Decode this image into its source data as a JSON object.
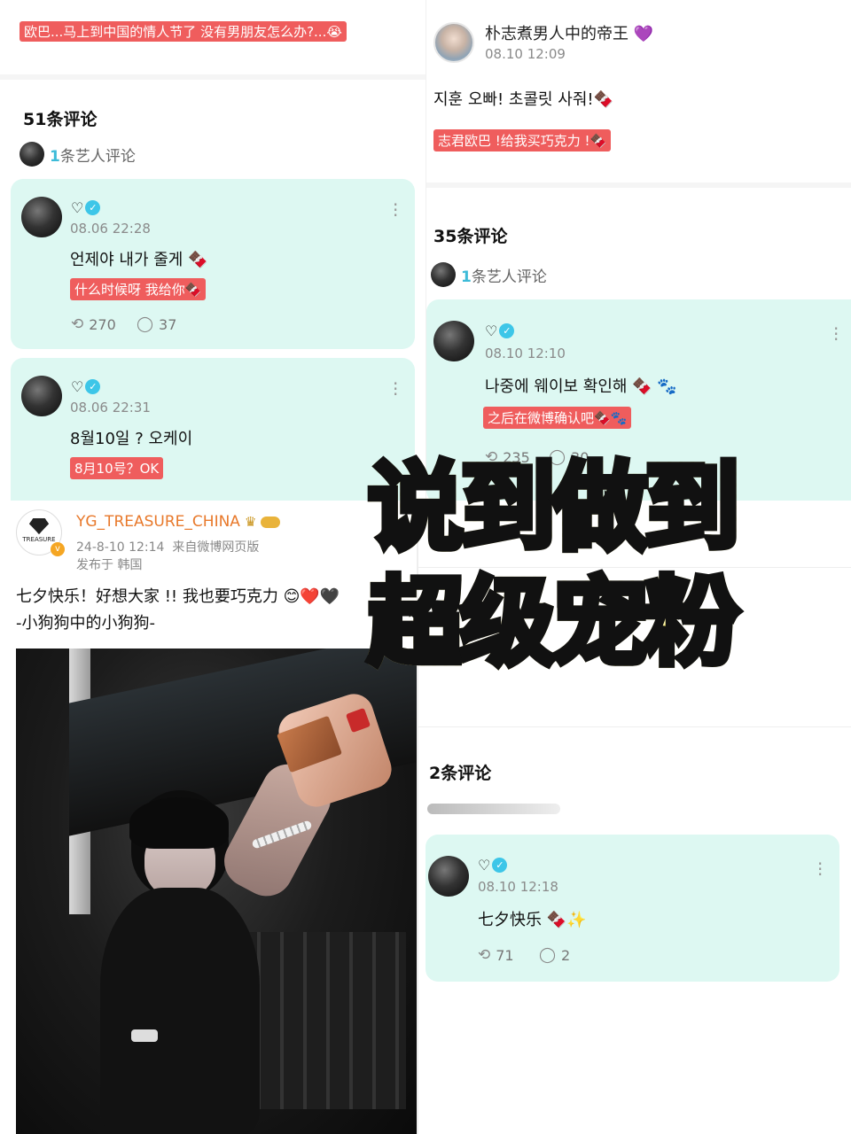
{
  "top_left": {
    "banner": "欧巴...马上到中国的情人节了 没有男朋友怎么办?...😭",
    "comment_count": "51条评论",
    "artist_comments": {
      "num": "1",
      "label": "条艺人评论"
    },
    "comments": [
      {
        "time": "08.06 22:28",
        "text": "언제야 내가 줄게 🍫",
        "translation": "什么时候呀 我给你🍫",
        "reposts": "270",
        "replies": "37"
      },
      {
        "time": "08.06 22:31",
        "text": "8월10일 ? 오케이",
        "translation": "8月10号？OK"
      }
    ]
  },
  "top_right": {
    "user": "朴志煮男人中的帝王 💜",
    "time": "08.10 12:09",
    "text": "지훈 오빠! 초콜릿 사줘!🍫",
    "translation": "志君欧巴 !给我买巧克力 !🍫",
    "comment_count": "35条评论",
    "artist_comments": {
      "num": "1",
      "label": "条艺人评论"
    },
    "comment": {
      "time": "08.10 12:10",
      "text": "나중에 웨이보 확인해 🍫 🐾",
      "translation": "之后在微博确认吧🍫🐾",
      "reposts": "235",
      "replies": "30"
    }
  },
  "bottom_left": {
    "account": "YG_TREASURE_CHINA",
    "logo_text": "TREASURE",
    "meta": "24-8-10 12:14  来自微博网页版",
    "location": "发布于 韩国",
    "text_line1": "七夕快乐！好想大家 !! 我也要巧克力 😊❤️🖤",
    "text_line2": "-小狗狗中的小狗狗-"
  },
  "bottom_right": {
    "comment_count": "2条评论",
    "comment": {
      "time": "08.10 12:18",
      "text": "七夕快乐 🍫✨",
      "reposts": "71",
      "replies": "2"
    }
  },
  "overlay": {
    "line1": "说到做到",
    "line2": "超级宠粉"
  },
  "colors": {
    "card_bg": "#ddf8f2",
    "translation_bg": "#ef5d5d",
    "accent": "#3dbbd8",
    "overlay_fill": "#f6f08a"
  },
  "icons": {
    "check": "verified-check-icon",
    "repost": "repost-icon",
    "reply": "reply-bubble-icon",
    "more": "more-dots-icon"
  }
}
